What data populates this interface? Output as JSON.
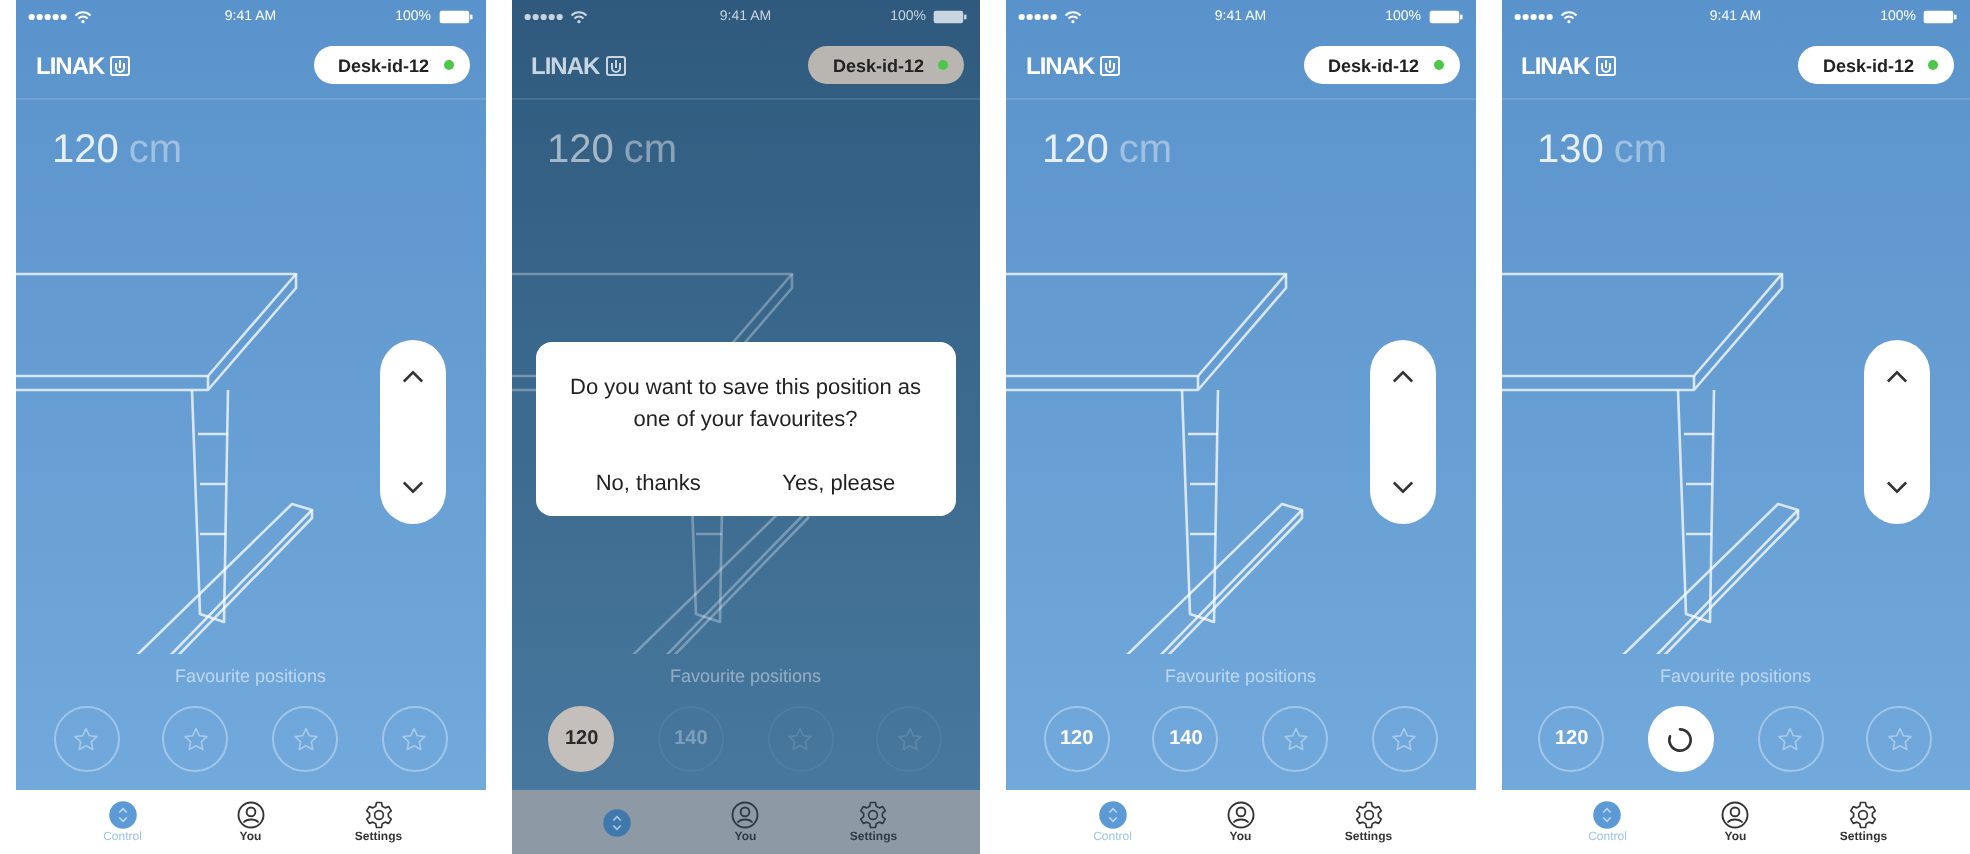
{
  "screens": [
    {
      "dimmed": false,
      "status_bar": {
        "time": "9:41 AM",
        "battery": "100%"
      },
      "brand": "LINAK",
      "device": {
        "name": "Desk-id-12",
        "connected": true
      },
      "height": {
        "value": "120",
        "unit": "cm"
      },
      "height_control": true,
      "favourites_label": "Favourite positions",
      "favourites": [
        {
          "kind": "empty",
          "selected": false
        },
        {
          "kind": "empty",
          "selected": false
        },
        {
          "kind": "empty",
          "selected": false
        },
        {
          "kind": "empty",
          "selected": false
        }
      ],
      "tabs": [
        {
          "label": "Control",
          "selected": true
        },
        {
          "label": "You",
          "selected": false
        },
        {
          "label": "Settings",
          "selected": false
        }
      ]
    },
    {
      "dimmed": true,
      "status_bar": {
        "time": "9:41 AM",
        "battery": "100%"
      },
      "brand": "LINAK",
      "device": {
        "name": "Desk-id-12",
        "connected": true
      },
      "height": {
        "value": "120",
        "unit": "cm"
      },
      "height_control": false,
      "favourites_label": "Favourite positions",
      "favourites": [
        {
          "kind": "value",
          "value": "120",
          "selected": true
        },
        {
          "kind": "value",
          "value": "140",
          "selected": false
        },
        {
          "kind": "empty",
          "selected": false
        },
        {
          "kind": "empty",
          "selected": false
        }
      ],
      "tabs": [
        {
          "selected": true
        },
        {
          "label": "You",
          "selected": false
        },
        {
          "label": "Settings",
          "selected": false
        }
      ],
      "dialog": {
        "message": "Do you want to save this position as one of your favourites?",
        "buttons": [
          "No, thanks",
          "Yes, please"
        ]
      }
    },
    {
      "dimmed": false,
      "status_bar": {
        "time": "9:41 AM",
        "battery": "100%"
      },
      "brand": "LINAK",
      "device": {
        "name": "Desk-id-12",
        "connected": true
      },
      "height": {
        "value": "120",
        "unit": "cm"
      },
      "height_control": true,
      "favourites_label": "Favourite positions",
      "favourites": [
        {
          "kind": "value",
          "value": "120",
          "selected": false
        },
        {
          "kind": "value",
          "value": "140",
          "selected": false
        },
        {
          "kind": "empty",
          "selected": false
        },
        {
          "kind": "empty",
          "selected": false
        }
      ],
      "tabs": [
        {
          "label": "Control",
          "selected": true
        },
        {
          "label": "You",
          "selected": false
        },
        {
          "label": "Settings",
          "selected": false
        }
      ]
    },
    {
      "dimmed": false,
      "status_bar": {
        "time": "9:41 AM",
        "battery": "100%"
      },
      "brand": "LINAK",
      "device": {
        "name": "Desk-id-12",
        "connected": true
      },
      "height": {
        "value": "130",
        "unit": "cm"
      },
      "height_control": true,
      "favourites_label": "Favourite positions",
      "favourites": [
        {
          "kind": "value",
          "value": "120",
          "selected": false
        },
        {
          "kind": "loading",
          "selected": false
        },
        {
          "kind": "empty",
          "selected": false
        },
        {
          "kind": "empty",
          "selected": false
        }
      ],
      "tabs": [
        {
          "label": "Control",
          "selected": true
        },
        {
          "label": "You",
          "selected": false
        },
        {
          "label": "Settings",
          "selected": false
        }
      ]
    }
  ]
}
